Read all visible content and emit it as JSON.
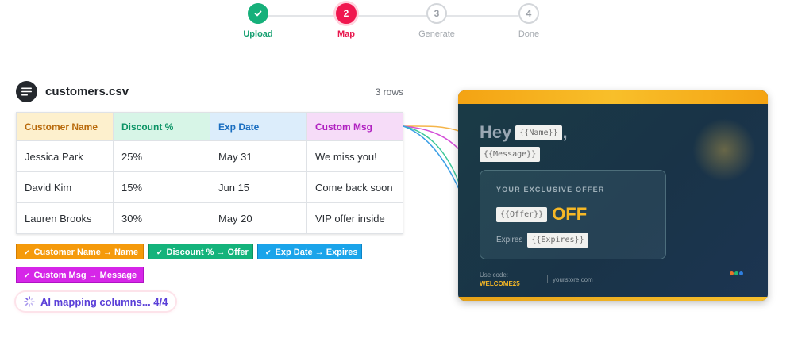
{
  "stepper": {
    "steps": [
      {
        "number": "1",
        "label": "Upload",
        "state": "done"
      },
      {
        "number": "2",
        "label": "Map",
        "state": "active"
      },
      {
        "number": "3",
        "label": "Generate",
        "state": "todo"
      },
      {
        "number": "4",
        "label": "Done",
        "state": "todo"
      }
    ]
  },
  "file": {
    "name": "customers.csv",
    "row_count": "3 rows",
    "icon": "list-icon"
  },
  "table": {
    "headers": [
      {
        "label": "Customer Name",
        "color": "#b8690a",
        "bg": "#fdf0cd"
      },
      {
        "label": "Discount %",
        "color": "#0c9466",
        "bg": "#d7f5e7"
      },
      {
        "label": "Exp Date",
        "color": "#1a6ec0",
        "bg": "#dcedfb"
      },
      {
        "label": "Custom Msg",
        "color": "#b020c0",
        "bg": "#f6dcf8"
      }
    ],
    "rows": [
      [
        "Jessica Park",
        "25%",
        "May 31",
        "We miss you!"
      ],
      [
        "David Kim",
        "15%",
        "Jun 15",
        "Come back soon"
      ],
      [
        "Lauren Brooks",
        "30%",
        "May 20",
        "VIP offer inside"
      ]
    ]
  },
  "mappings": [
    {
      "label": "Customer Name → Name",
      "color": "#f59a0b",
      "border": "#d47d00"
    },
    {
      "label": "Discount % → Offer",
      "color": "#14b37b",
      "border": "#0e925f"
    },
    {
      "label": "Exp Date → Expires",
      "color": "#1aa4ea",
      "border": "#0b84c6"
    },
    {
      "label": "Custom Msg → Message",
      "color": "#d626e8",
      "border": "#b012c4"
    }
  ],
  "ai_status": {
    "text": "AI mapping columns... 4/4",
    "icon": "spinner-icon"
  },
  "template": {
    "greeting": "Hey",
    "name_tag": "{{Name}}",
    "comma": ",",
    "message_tag": "{{Message}}",
    "offer_title": "YOUR EXCLUSIVE OFFER",
    "offer_tag": "{{Offer}}",
    "offer_suffix": "OFF",
    "expires_label": "Expires",
    "expires_tag": "{{Expires}}",
    "use_code_label": "Use code:",
    "coupon_code": "WELCOME25",
    "store_url": "yourstore.com",
    "dot_colors": [
      "#e8742a",
      "#22b573",
      "#2f7fe0"
    ]
  },
  "connector_colors": [
    "#f5b54a",
    "#d44fd8",
    "#3dc79a",
    "#3a9ee6"
  ]
}
